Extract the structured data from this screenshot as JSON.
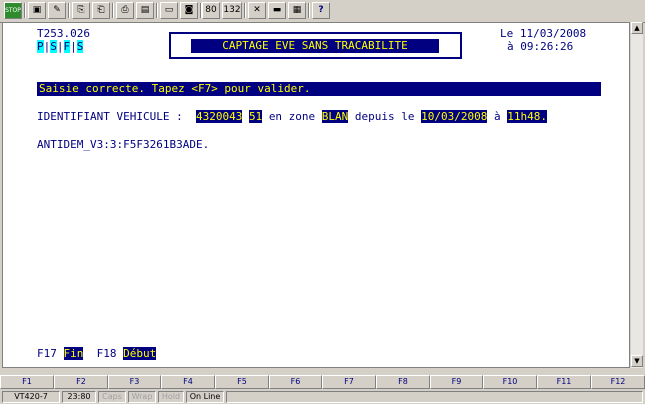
{
  "toolbar": {
    "buttons": [
      {
        "name": "stop-icon",
        "label": "STOP"
      },
      {
        "name": "computer-icon",
        "label": "▣"
      },
      {
        "name": "tools-icon",
        "label": "✎"
      },
      {
        "name": "copy-icon",
        "label": "⎘"
      },
      {
        "name": "paste-icon",
        "label": "⎗"
      },
      {
        "name": "print-icon",
        "label": "⎙"
      },
      {
        "name": "print-screen-icon",
        "label": "▤"
      },
      {
        "name": "screen-icon",
        "label": "▭"
      },
      {
        "name": "camera-icon",
        "label": "◙"
      },
      {
        "name": "cols-80-button",
        "label": "80"
      },
      {
        "name": "cols-132-button",
        "label": "132"
      },
      {
        "name": "settings-icon",
        "label": "✕"
      },
      {
        "name": "keyboard-icon",
        "label": "▬"
      },
      {
        "name": "grid-icon",
        "label": "▦"
      },
      {
        "name": "help-icon",
        "label": "?"
      }
    ]
  },
  "screen": {
    "transaction": "T253.026",
    "psfs": [
      "P",
      "S",
      "F",
      "S"
    ],
    "title": "CAPTAGE EVE SANS TRACABILITE",
    "date_label": "Le",
    "date": "11/03/2008",
    "time_label": "à",
    "time": "09:26:26",
    "message": "Saisie correcte. Tapez <F7> pour valider.",
    "vehicle_label": "IDENTIFIANT VEHICULE :",
    "vehicle_id": "4320043",
    "vehicle_num": "51",
    "zone_label": "en zone",
    "zone": "BLAN",
    "since_label": "depuis le",
    "since_date": "10/03/2008",
    "at_label": "à",
    "since_time": "11h48.",
    "antidem": "ANTIDEM_V3:3:F5F3261B3ADE.",
    "f17_label": "F17",
    "f17_value": "Fin",
    "f18_label": "F18",
    "f18_value": "Début"
  },
  "fkeys": [
    "F1",
    "F2",
    "F3",
    "F4",
    "F5",
    "F6",
    "F7",
    "F8",
    "F9",
    "F10",
    "F11",
    "F12"
  ],
  "status": {
    "terminal": "VT420-7",
    "cursor": "23:80",
    "caps": "Caps",
    "wrap": "Wrap",
    "hold": "Hold",
    "online": "On Line"
  }
}
